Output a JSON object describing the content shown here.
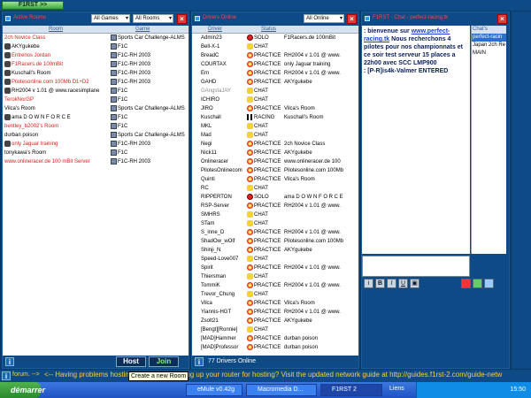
{
  "topbar": {
    "first_label": "F1RST >>"
  },
  "rooms": {
    "title": "Active Rooms",
    "filter_games": "All Games",
    "filter_rooms": "All Rooms",
    "col_room": "Room",
    "col_game": "Game",
    "items": [
      {
        "name": "2ch Novice Class",
        "color": "#e01b1b",
        "icon": "none",
        "game": "Sports Car Challenge-ALMS"
      },
      {
        "name": "AKYgukebe",
        "color": "#000000",
        "icon": "lock",
        "game": "F1C"
      },
      {
        "name": "Entrenos Jordan",
        "color": "#e01b1b",
        "icon": "lock",
        "game": "F1C-RH 2003"
      },
      {
        "name": "F1Racers.de 100mBit",
        "color": "#e01b1b",
        "icon": "lock",
        "game": "F1C-RH 2003"
      },
      {
        "name": "Kuschall's Room",
        "color": "#000000",
        "icon": "lock",
        "game": "F1C-RH 2003"
      },
      {
        "name": "Pilotesonline.com 100Mb D1+D2",
        "color": "#e01b1b",
        "icon": "lock",
        "game": "F1C-RH 2003"
      },
      {
        "name": "RH2004 v 1.01 @ www.racesimplane",
        "color": "#000000",
        "icon": "lock",
        "game": "F1C"
      },
      {
        "name": "TerokNorGP",
        "color": "#e01b1b",
        "icon": "none",
        "game": "F1C"
      },
      {
        "name": "Vilca's Room",
        "color": "#000000",
        "icon": "none",
        "game": "Sports Car Challenge-ALMS"
      },
      {
        "name": "ama D O W N F O R C E",
        "color": "#000000",
        "icon": "lock",
        "game": "F1C"
      },
      {
        "name": "bentley_b2002's Room",
        "color": "#e01b1b",
        "icon": "none",
        "game": "F1C"
      },
      {
        "name": "durban poison",
        "color": "#000000",
        "icon": "none",
        "game": "Sports Car Challenge-ALMS"
      },
      {
        "name": "only Jaguar training",
        "color": "#e01b1b",
        "icon": "lock",
        "game": "F1C-RH 2003"
      },
      {
        "name": "tonykawa's Room",
        "color": "#000000",
        "icon": "none",
        "game": "F1C"
      },
      {
        "name": "www.onlineracer.de 100 mBit Server",
        "color": "#e01b1b",
        "icon": "none",
        "game": "F1C-RH 2003"
      }
    ],
    "host_label": "Host",
    "join_label": "Join"
  },
  "drivers": {
    "title": "Drivers Online",
    "filter": "All Online",
    "col_driver": "Driver",
    "col_status": "Status",
    "count_label": "77 Drivers Online",
    "items": [
      {
        "name": "Admin23",
        "status": "SOLO",
        "room": "F1Racers.de 100mBit",
        "st": "solo"
      },
      {
        "name": "Bell-X-1",
        "status": "CHAT",
        "room": "",
        "st": "chat"
      },
      {
        "name": "BreadC",
        "status": "PRACTICE",
        "room": "RH2004 v 1.01 @ www.",
        "st": "pr"
      },
      {
        "name": "COURTAX",
        "status": "PRACTICE",
        "room": "only Jaguar training",
        "st": "pr"
      },
      {
        "name": "Ern",
        "status": "PRACTICE",
        "room": "RH2004 v 1.01 @ www.",
        "st": "pr"
      },
      {
        "name": "GAHD",
        "status": "PRACTICE",
        "room": "AKYgukebe",
        "st": "pr"
      },
      {
        "name": "GAngstaJAY",
        "status": "CHAT",
        "room": "",
        "st": "chat",
        "grey": true
      },
      {
        "name": "ICHIRO",
        "status": "CHAT",
        "room": "",
        "st": "chat"
      },
      {
        "name": "JIRO",
        "status": "PRACTICE",
        "room": "Vilca's Room",
        "st": "pr"
      },
      {
        "name": "Kuschall",
        "status": "RACING",
        "room": "Kuschall's Room",
        "st": "rc"
      },
      {
        "name": "MKL",
        "status": "CHAT",
        "room": "",
        "st": "chat"
      },
      {
        "name": "Mad",
        "status": "CHAT",
        "room": "",
        "st": "chat"
      },
      {
        "name": "Negi",
        "status": "PRACTICE",
        "room": "2ch Novice Class",
        "st": "pr"
      },
      {
        "name": "Nick11",
        "status": "PRACTICE",
        "room": "AKYgukebe",
        "st": "pr"
      },
      {
        "name": "Onlineracer",
        "status": "PRACTICE",
        "room": "www.onlineracer.de 100",
        "st": "pr"
      },
      {
        "name": "PilotesOnlinecom",
        "status": "PRACTICE",
        "room": "Pilotesonline.com 100Mb",
        "st": "pr"
      },
      {
        "name": "Quinti",
        "status": "PRACTICE",
        "room": "Vilca's Room",
        "st": "pr"
      },
      {
        "name": "RC",
        "status": "CHAT",
        "room": "",
        "st": "chat"
      },
      {
        "name": "RIPPERTON",
        "status": "SOLO",
        "room": "ama D O W N F O R C E",
        "st": "solo"
      },
      {
        "name": "RSP-Server",
        "status": "PRACTICE",
        "room": "RH2004 v 1.01 @ www.",
        "st": "pr"
      },
      {
        "name": "SMHRS",
        "status": "CHAT",
        "room": "",
        "st": "chat"
      },
      {
        "name": "STam",
        "status": "CHAT",
        "room": "",
        "st": "chat"
      },
      {
        "name": "S_inne_D",
        "status": "PRACTICE",
        "room": "RH2004 v 1.01 @ www.",
        "st": "pr"
      },
      {
        "name": "ShadOw_wOlf",
        "status": "PRACTICE",
        "room": "Pilotesonline.com 100Mb",
        "st": "pr"
      },
      {
        "name": "Shinji_N",
        "status": "PRACTICE",
        "room": "AKYgukebe",
        "st": "pr"
      },
      {
        "name": "Speed-Love007",
        "status": "CHAT",
        "room": "",
        "st": "chat"
      },
      {
        "name": "Spirit",
        "status": "PRACTICE",
        "room": "RH2004 v 1.01 @ www.",
        "st": "pr"
      },
      {
        "name": "Thiersman",
        "status": "CHAT",
        "room": "",
        "st": "chat"
      },
      {
        "name": "TommiK",
        "status": "PRACTICE",
        "room": "RH2004 v 1.01 @ www.",
        "st": "pr"
      },
      {
        "name": "Trevor_Chung",
        "status": "CHAT",
        "room": "",
        "st": "chat"
      },
      {
        "name": "Vilca",
        "status": "PRACTICE",
        "room": "Vilca's Room",
        "st": "pr"
      },
      {
        "name": "Yiannis-HGT",
        "status": "PRACTICE",
        "room": "RH2004 v 1.01 @ www.",
        "st": "pr"
      },
      {
        "name": "Zsolt21",
        "status": "PRACTICE",
        "room": "AKYgukebe",
        "st": "pr"
      },
      {
        "name": "[Bengt][Ronnie]",
        "status": "CHAT",
        "room": "",
        "st": "chat"
      },
      {
        "name": "[MAD]Hammer",
        "status": "PRACTICE",
        "room": "durban poison",
        "st": "pr"
      },
      {
        "name": "[MAD]Professor",
        "status": "PRACTICE",
        "room": "durban poison",
        "st": "pr"
      }
    ]
  },
  "chat": {
    "title": "F1RST - Chat - perfect-racing.tk",
    "msg_prefix": ": bienvenue sur ",
    "msg_link": "www.perfect-racing.tk",
    "msg_body": " Nous recherchons 4 pilotes pour nos championnats et ce soir test serveur 15 places a 22h00  avec SCC LMP900",
    "msg_enter": ":  [P-R]is4k-Valmer ENTERED",
    "chans_title": "Chat's",
    "chans": [
      "perfect-racin",
      "Japan 2ch Re",
      "MAIN"
    ],
    "tools": [
      "i",
      "B",
      "I",
      "U",
      "▣"
    ]
  },
  "lower": {
    "forum_text": "forum. -->",
    "ticker": "<-- Having problems hosting? Need help setting up your router for hosting? Visit the updated network guide at http://guides.f1rst-2.com/guide-netw",
    "tooltip": "Create a new Room"
  },
  "taskbar": {
    "start": "démarrer",
    "items": [
      "eMule v0.42g",
      "Macromedia D...",
      "F1RST 2"
    ],
    "liens": "Liens",
    "clock": "15:50"
  }
}
